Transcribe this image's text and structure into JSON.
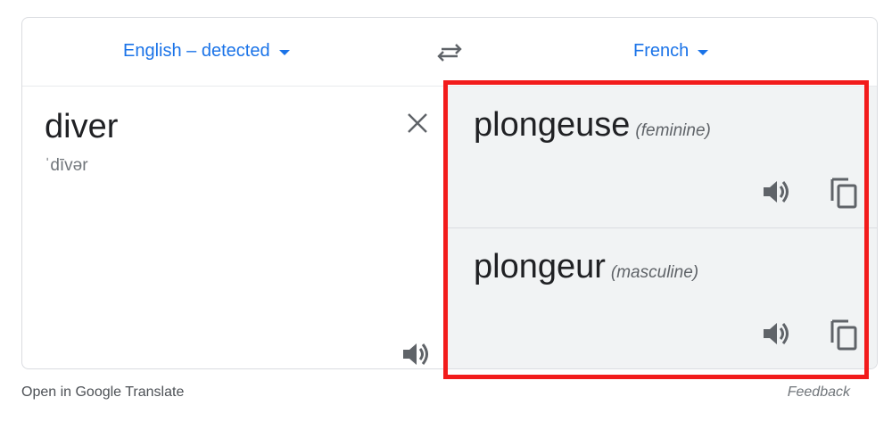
{
  "source_language": "English – detected",
  "target_language": "French",
  "source": {
    "word": "diver",
    "phonetic": "ˈdīvər"
  },
  "translations": [
    {
      "word": "plongeuse",
      "gender": "(feminine)"
    },
    {
      "word": "plongeur",
      "gender": "(masculine)"
    }
  ],
  "footer": {
    "open_link": "Open in Google Translate",
    "feedback": "Feedback"
  },
  "colors": {
    "link_blue": "#1a73e8",
    "highlight_red": "#f21b1b",
    "target_bg": "#f1f3f4"
  },
  "icons": [
    "swap-languages-icon",
    "clear-icon",
    "speaker-icon",
    "copy-icon",
    "dropdown-caret-icon"
  ]
}
